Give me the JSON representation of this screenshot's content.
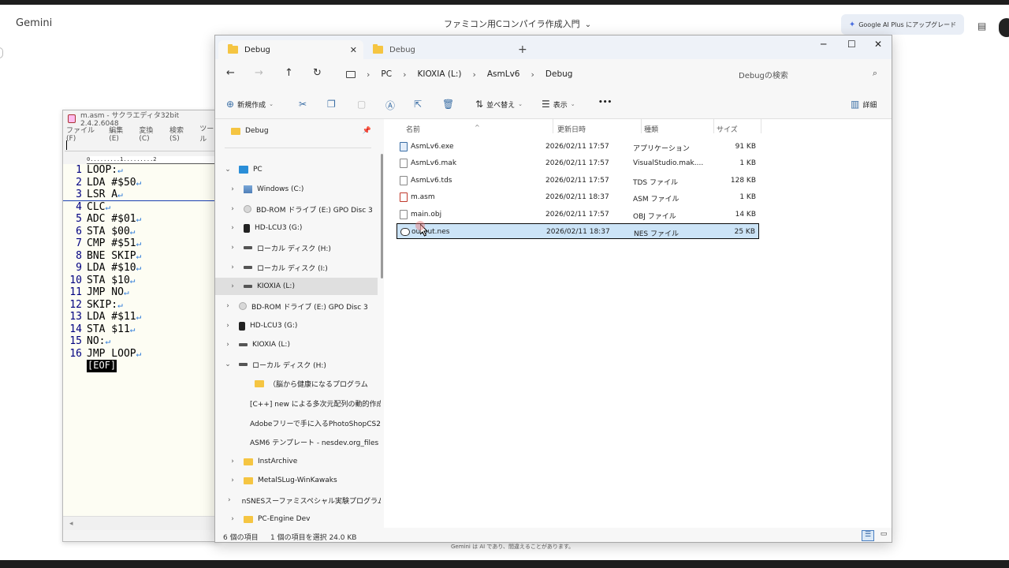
{
  "gemini": {
    "brand": "Gemini",
    "chat_title": "ファミコン用Cコンパイラ作成入門",
    "upgrade_label": "Google AI Plus にアップグレード",
    "footer": "Gemini は AI であり、間違えることがあります。"
  },
  "sakura": {
    "title": "m.asm - サクラエディタ32bit 2.4.2.6048",
    "menu": [
      "ファイル(F)",
      "編集(E)",
      "変換(C)",
      "検索(S)",
      "ツール"
    ],
    "ruler": "0.........1.........2",
    "lines": [
      {
        "n": "1",
        "code": "LOOP:"
      },
      {
        "n": "2",
        "code": "LDA #$50"
      },
      {
        "n": "3",
        "code": "LSR A"
      },
      {
        "n": "4",
        "code": "CLC"
      },
      {
        "n": "5",
        "code": "ADC #$01"
      },
      {
        "n": "6",
        "code": "STA $00"
      },
      {
        "n": "7",
        "code": "CMP #$51"
      },
      {
        "n": "8",
        "code": "BNE SKIP"
      },
      {
        "n": "9",
        "code": "LDA #$10"
      },
      {
        "n": "10",
        "code": "STA $10"
      },
      {
        "n": "11",
        "code": "JMP NO"
      },
      {
        "n": "12",
        "code": "SKIP:"
      },
      {
        "n": "13",
        "code": "LDA #$11"
      },
      {
        "n": "14",
        "code": "STA $11"
      },
      {
        "n": "15",
        "code": "NO:"
      },
      {
        "n": "16",
        "code": "JMP LOOP"
      }
    ],
    "return_mark": "↵",
    "eof": "[EOF]",
    "scroll_left": "◂"
  },
  "explorer": {
    "tabs": [
      {
        "label": "Debug"
      },
      {
        "label": "Debug"
      }
    ],
    "tab_close": "✕",
    "new_tab": "+",
    "win": {
      "min": "─",
      "max": "☐",
      "close": "✕"
    },
    "nav": {
      "back": "←",
      "forward": "→",
      "up": "↑",
      "refresh": "↻"
    },
    "breadcrumb": [
      "PC",
      "KIOXIA (L:)",
      "AsmLv6",
      "Debug"
    ],
    "breadcrumb_sep": "›",
    "search_placeholder": "Debugの検索",
    "cmd": {
      "new": "新規作成",
      "sort": "並べ替え",
      "view": "表示",
      "more": "•••",
      "details": "詳細"
    },
    "navpane": [
      {
        "label": "Debug",
        "kind": "folder",
        "pinned": true
      },
      {
        "label": "PC",
        "kind": "pc",
        "chev": "⌄"
      },
      {
        "label": "Windows (C:)",
        "kind": "win",
        "chev": "›"
      },
      {
        "label": "BD-ROM ドライブ (E:) GPO Disc 3",
        "kind": "disc",
        "chev": "›"
      },
      {
        "label": "HD-LCU3 (G:)",
        "kind": "ext",
        "chev": "›"
      },
      {
        "label": "ローカル ディスク (H:)",
        "kind": "drive",
        "chev": "›"
      },
      {
        "label": "ローカル ディスク (I:)",
        "kind": "drive",
        "chev": "›"
      },
      {
        "label": "KIOXIA (L:)",
        "kind": "drive",
        "chev": "›",
        "selected": true
      },
      {
        "label": "BD-ROM ドライブ (E:) GPO Disc 3",
        "kind": "disc",
        "chev": "›"
      },
      {
        "label": "HD-LCU3 (G:)",
        "kind": "ext",
        "chev": "›"
      },
      {
        "label": "KIOXIA (L:)",
        "kind": "drive",
        "chev": "›"
      },
      {
        "label": "ローカル ディスク (H:)",
        "kind": "drive",
        "chev": "⌄"
      },
      {
        "label": "（脳から健康になるプログラム",
        "kind": "folder",
        "chev": ""
      },
      {
        "label": "[C++] new による多次元配列の動的作成",
        "kind": "folder",
        "chev": ""
      },
      {
        "label": "Adobeフリーで手に入るPhotoShopCS2",
        "kind": "folder",
        "chev": ""
      },
      {
        "label": "ASM6 テンプレート - nesdev.org_files",
        "kind": "folder",
        "chev": ""
      },
      {
        "label": "InstArchive",
        "kind": "folder",
        "chev": "›"
      },
      {
        "label": "MetalSLug-WinKawaks",
        "kind": "folder",
        "chev": "›"
      },
      {
        "label": "nSNESスーファミスペシャル実験プログラム",
        "kind": "folder",
        "chev": "›"
      },
      {
        "label": "PC-Engine Dev",
        "kind": "folder",
        "chev": "›"
      }
    ],
    "columns": {
      "name": "名前",
      "date": "更新日時",
      "type": "種類",
      "size": "サイズ"
    },
    "files": [
      {
        "name": "AsmLv6.exe",
        "date": "2026/02/11 17:57",
        "type": "アプリケーション",
        "size": "91 KB",
        "icon": "exe"
      },
      {
        "name": "AsmLv6.mak",
        "date": "2026/02/11 17:57",
        "type": "VisualStudio.mak....",
        "size": "1 KB",
        "icon": "doc"
      },
      {
        "name": "AsmLv6.tds",
        "date": "2026/02/11 17:57",
        "type": "TDS ファイル",
        "size": "128 KB",
        "icon": "doc"
      },
      {
        "name": "m.asm",
        "date": "2026/02/11 18:37",
        "type": "ASM ファイル",
        "size": "1 KB",
        "icon": "asm"
      },
      {
        "name": "main.obj",
        "date": "2026/02/11 17:57",
        "type": "OBJ ファイル",
        "size": "14 KB",
        "icon": "doc"
      },
      {
        "name": "output.nes",
        "date": "2026/02/11 18:37",
        "type": "NES ファイル",
        "size": "25 KB",
        "icon": "nes",
        "selected": true
      }
    ],
    "status": {
      "count": "6 個の項目",
      "selection": "1 個の項目を選択  24.0 KB"
    }
  }
}
